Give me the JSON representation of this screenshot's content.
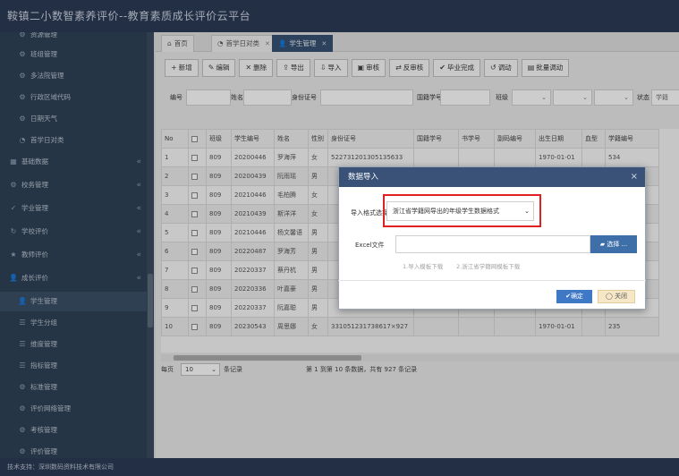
{
  "app": {
    "title": "鞍镇二小数智素养评价--教育素质成长评价云平台"
  },
  "sidebar": {
    "items": [
      {
        "label": "资源管理",
        "kind": "sub",
        "icon": "gear-icon"
      },
      {
        "label": "班组管理",
        "kind": "sub",
        "icon": "gear-icon"
      },
      {
        "label": "多法院管理",
        "kind": "sub",
        "icon": "gear-icon"
      },
      {
        "label": "行政区域代码",
        "kind": "sub",
        "icon": "gear-icon"
      },
      {
        "label": "日期天气",
        "kind": "sub",
        "icon": "gear-icon"
      },
      {
        "label": "首学日对类",
        "kind": "sub",
        "icon": "pie-icon"
      },
      {
        "label": "基础数据",
        "kind": "top",
        "icon": "grid-icon"
      },
      {
        "label": "校务管理",
        "kind": "top",
        "icon": "gear-icon"
      },
      {
        "label": "学业管理",
        "kind": "top",
        "icon": "check-icon"
      },
      {
        "label": "学校评价",
        "kind": "top",
        "icon": "refresh-icon"
      },
      {
        "label": "教师评价",
        "kind": "top",
        "icon": "star-icon"
      },
      {
        "label": "成长评价",
        "kind": "top",
        "icon": "user-icon"
      },
      {
        "label": "学生管理",
        "kind": "sub",
        "icon": "user-icon"
      },
      {
        "label": "学生分组",
        "kind": "sub",
        "icon": "list-icon"
      },
      {
        "label": "维度管理",
        "kind": "sub",
        "icon": "list-icon"
      },
      {
        "label": "指标管理",
        "kind": "sub",
        "icon": "list-icon"
      },
      {
        "label": "标准管理",
        "kind": "sub",
        "icon": "gear-icon"
      },
      {
        "label": "评价网络管理",
        "kind": "sub",
        "icon": "gear-icon"
      },
      {
        "label": "考核管理",
        "kind": "sub",
        "icon": "gear-icon"
      },
      {
        "label": "评价管理",
        "kind": "sub",
        "icon": "gear-icon"
      }
    ],
    "expand_arrow": "«"
  },
  "footer": {
    "text": "技术支持：深圳数码资料技术有限公司"
  },
  "tabs": [
    {
      "label": "首页",
      "icon": "home-icon",
      "closable": false,
      "active": false
    },
    {
      "label": "首学日对类",
      "icon": "pie-icon",
      "closable": true,
      "active": false
    },
    {
      "label": "学生管理",
      "icon": "user-icon",
      "closable": true,
      "active": true
    }
  ],
  "close_glyph": "✕",
  "toolbar": [
    {
      "label": "新增",
      "icon": "+"
    },
    {
      "label": "编辑",
      "icon": "✎"
    },
    {
      "label": "删除",
      "icon": "✕"
    },
    {
      "label": "导出",
      "icon": "⇪"
    },
    {
      "label": "导入",
      "icon": "⇩"
    },
    {
      "label": "审核",
      "icon": "▣"
    },
    {
      "label": "反审核",
      "icon": "⇄"
    },
    {
      "label": "毕业完成",
      "icon": "✔"
    },
    {
      "label": "调动",
      "icon": "↺"
    },
    {
      "label": "批量调动",
      "icon": "▤"
    }
  ],
  "filter": {
    "labels": [
      "编号",
      "姓名",
      "身份证号",
      "国籍学号",
      "班级",
      "状态"
    ],
    "status_value": "学籍",
    "dropdown_glyph": "⌄"
  },
  "table": {
    "columns": [
      "No",
      "",
      "班级",
      "学生编号",
      "姓名",
      "性别",
      "身份证号",
      "国籍学号",
      "书学号",
      "副码编号",
      "出生日期",
      "血型",
      "学籍编号"
    ],
    "rows": [
      [
        "1",
        "",
        "809",
        "20200446",
        "罗海萍",
        "女",
        "522731201305135633",
        "",
        "",
        "",
        "1970-01-01",
        "",
        "534"
      ],
      [
        "2",
        "",
        "809",
        "20200439",
        "阮雨瑶",
        "男",
        "",
        "",
        "",
        "",
        "",
        "",
        ""
      ],
      [
        "3",
        "",
        "809",
        "20210446",
        "毛柏腾",
        "女",
        "",
        "",
        "",
        "",
        "",
        "",
        ""
      ],
      [
        "4",
        "",
        "809",
        "20210439",
        "斯洋洋",
        "女",
        "",
        "",
        "",
        "",
        "",
        "",
        ""
      ],
      [
        "5",
        "",
        "809",
        "20210446",
        "杨文馨语",
        "男",
        "",
        "",
        "",
        "",
        "",
        "",
        ""
      ],
      [
        "6",
        "",
        "809",
        "20220487",
        "罗海芳",
        "男",
        "",
        "",
        "",
        "",
        "",
        "",
        ""
      ],
      [
        "7",
        "",
        "809",
        "20220337",
        "蔡丹杭",
        "男",
        "",
        "",
        "",
        "",
        "",
        "",
        ""
      ],
      [
        "8",
        "",
        "809",
        "20220336",
        "叶嘉豪",
        "男",
        "",
        "",
        "",
        "",
        "",
        "",
        ""
      ],
      [
        "9",
        "",
        "809",
        "20220337",
        "阮嘉聪",
        "男",
        "",
        "",
        "",
        "",
        "",
        "",
        ""
      ],
      [
        "10",
        "",
        "809",
        "20230543",
        "周思娜",
        "女",
        "331051231738617×927",
        "",
        "",
        "",
        "1970-01-01",
        "",
        "235"
      ]
    ]
  },
  "pager": {
    "per_page_label": "每页",
    "per_page_value": "10",
    "per_page_suffix": "条记录",
    "summary": "第 1 到第 10 条数据，共有 927 条记录"
  },
  "dialog": {
    "title": "数据导入",
    "close": "×",
    "format_label": "导入格式选择",
    "format_value": "浙江省学籍网导出的年级学生数据格式",
    "file_label": "Excel文件",
    "choose_label": "选择 ...",
    "hint1": "1.导入模板下载",
    "hint2": "2.浙江省学籍网模板下载",
    "ok_label": "确定",
    "cancel_label": "关闭"
  }
}
